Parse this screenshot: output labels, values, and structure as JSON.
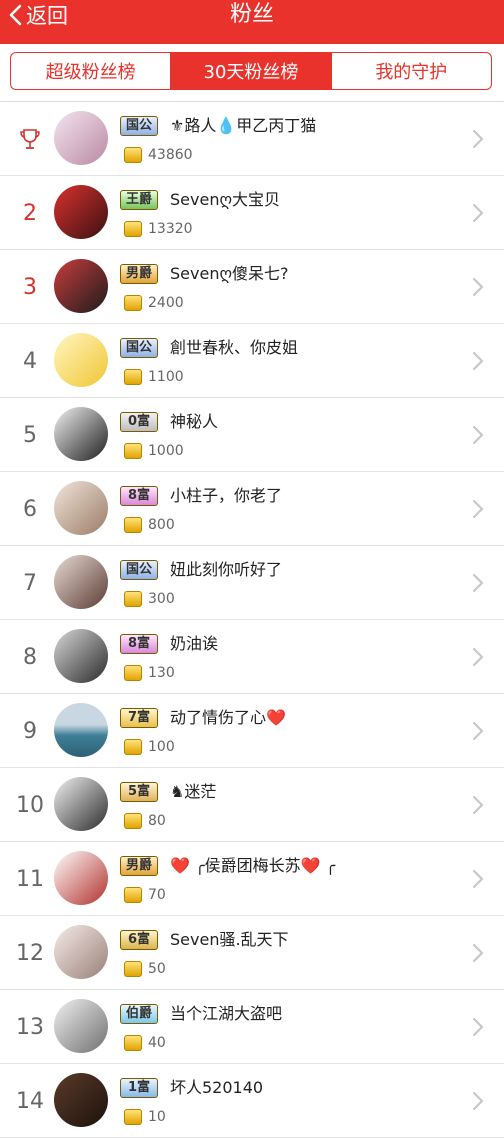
{
  "header": {
    "back_label": "返回",
    "title": "粉丝"
  },
  "tabs": [
    {
      "label": "超级粉丝榜",
      "active": false
    },
    {
      "label": "30天粉丝榜",
      "active": true
    },
    {
      "label": "我的守护",
      "active": false
    }
  ],
  "fans": [
    {
      "rank": "",
      "level": "国公",
      "name": "⚜路人💧甲乙丙丁猫",
      "coins": "43860"
    },
    {
      "rank": "2",
      "level": "王爵",
      "name": "Sevenღ大宝贝",
      "coins": "13320"
    },
    {
      "rank": "3",
      "level": "男爵",
      "name": "Sevenღ傻呆七?",
      "coins": "2400"
    },
    {
      "rank": "4",
      "level": "国公",
      "name": "創世春秋、你皮姐",
      "coins": "1100"
    },
    {
      "rank": "5",
      "level": "0富",
      "name": "神秘人",
      "coins": "1000"
    },
    {
      "rank": "6",
      "level": "8富",
      "name": "小柱子，你老了",
      "coins": "800"
    },
    {
      "rank": "7",
      "level": "国公",
      "name": "妞此刻你听好了",
      "coins": "300"
    },
    {
      "rank": "8",
      "level": "8富",
      "name": "奶油诶",
      "coins": "130"
    },
    {
      "rank": "9",
      "level": "7富",
      "name": "动了情伤了心❤️",
      "coins": "100"
    },
    {
      "rank": "10",
      "level": "5富",
      "name": "♞迷茫",
      "coins": "80"
    },
    {
      "rank": "11",
      "level": "男爵",
      "name": "❤️ ╭侯爵团梅长苏❤️ ╭",
      "coins": "70"
    },
    {
      "rank": "12",
      "level": "6富",
      "name": "Seven骚.乱天下",
      "coins": "50"
    },
    {
      "rank": "13",
      "level": "伯爵",
      "name": "当个江湖大盗吧",
      "coins": "40"
    },
    {
      "rank": "14",
      "level": "1富",
      "name": "坏人520140",
      "coins": "10"
    }
  ]
}
